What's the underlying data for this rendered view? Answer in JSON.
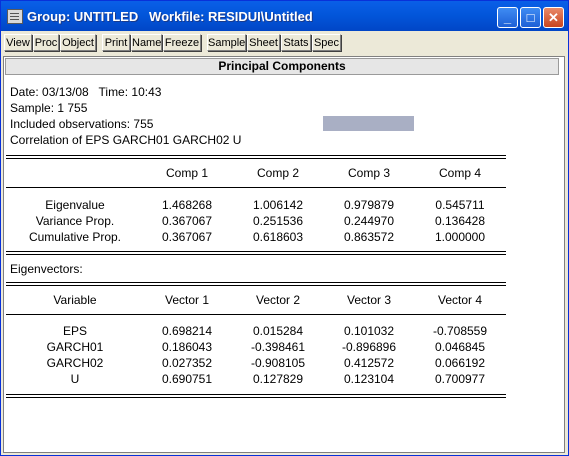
{
  "window": {
    "title": "Group: UNTITLED   Workfile: RESIDUI\\Untitled",
    "controls": {
      "minimize": "_",
      "maximize": "□",
      "close": "✕"
    }
  },
  "toolbar": [
    "View",
    "Proc",
    "Object",
    "Print",
    "Name",
    "Freeze",
    "Sample",
    "Sheet",
    "Stats",
    "Spec"
  ],
  "panel_title": "Principal Components",
  "info": {
    "date_line": "Date: 03/13/08   Time: 10:43",
    "sample_line": "Sample: 1 755",
    "obs_line": "Included observations: 755",
    "corr_line": "Correlation of EPS GARCH01 GARCH02 U"
  },
  "components": {
    "headers": [
      "Comp 1",
      "Comp 2",
      "Comp 3",
      "Comp 4"
    ],
    "rows": [
      {
        "label": "Eigenvalue",
        "values": [
          "1.468268",
          "1.006142",
          "0.979879",
          "0.545711"
        ]
      },
      {
        "label": "Variance Prop.",
        "values": [
          "0.367067",
          "0.251536",
          "0.244970",
          "0.136428"
        ]
      },
      {
        "label": "Cumulative Prop.",
        "values": [
          "0.367067",
          "0.618603",
          "0.863572",
          "1.000000"
        ]
      }
    ]
  },
  "eigenvectors": {
    "section_label": "Eigenvectors:",
    "variable_header": "Variable",
    "headers": [
      "Vector 1",
      "Vector 2",
      "Vector 3",
      "Vector 4"
    ],
    "rows": [
      {
        "label": "EPS",
        "values": [
          "0.698214",
          "0.015284",
          "0.101032",
          "-0.708559"
        ]
      },
      {
        "label": "GARCH01",
        "values": [
          "0.186043",
          "-0.398461",
          "-0.896896",
          "0.046845"
        ]
      },
      {
        "label": "GARCH02",
        "values": [
          "0.027352",
          "-0.908105",
          "0.412572",
          "0.066192"
        ]
      },
      {
        "label": "U",
        "values": [
          "0.690751",
          "0.127829",
          "0.123104",
          "0.700977"
        ]
      }
    ]
  }
}
